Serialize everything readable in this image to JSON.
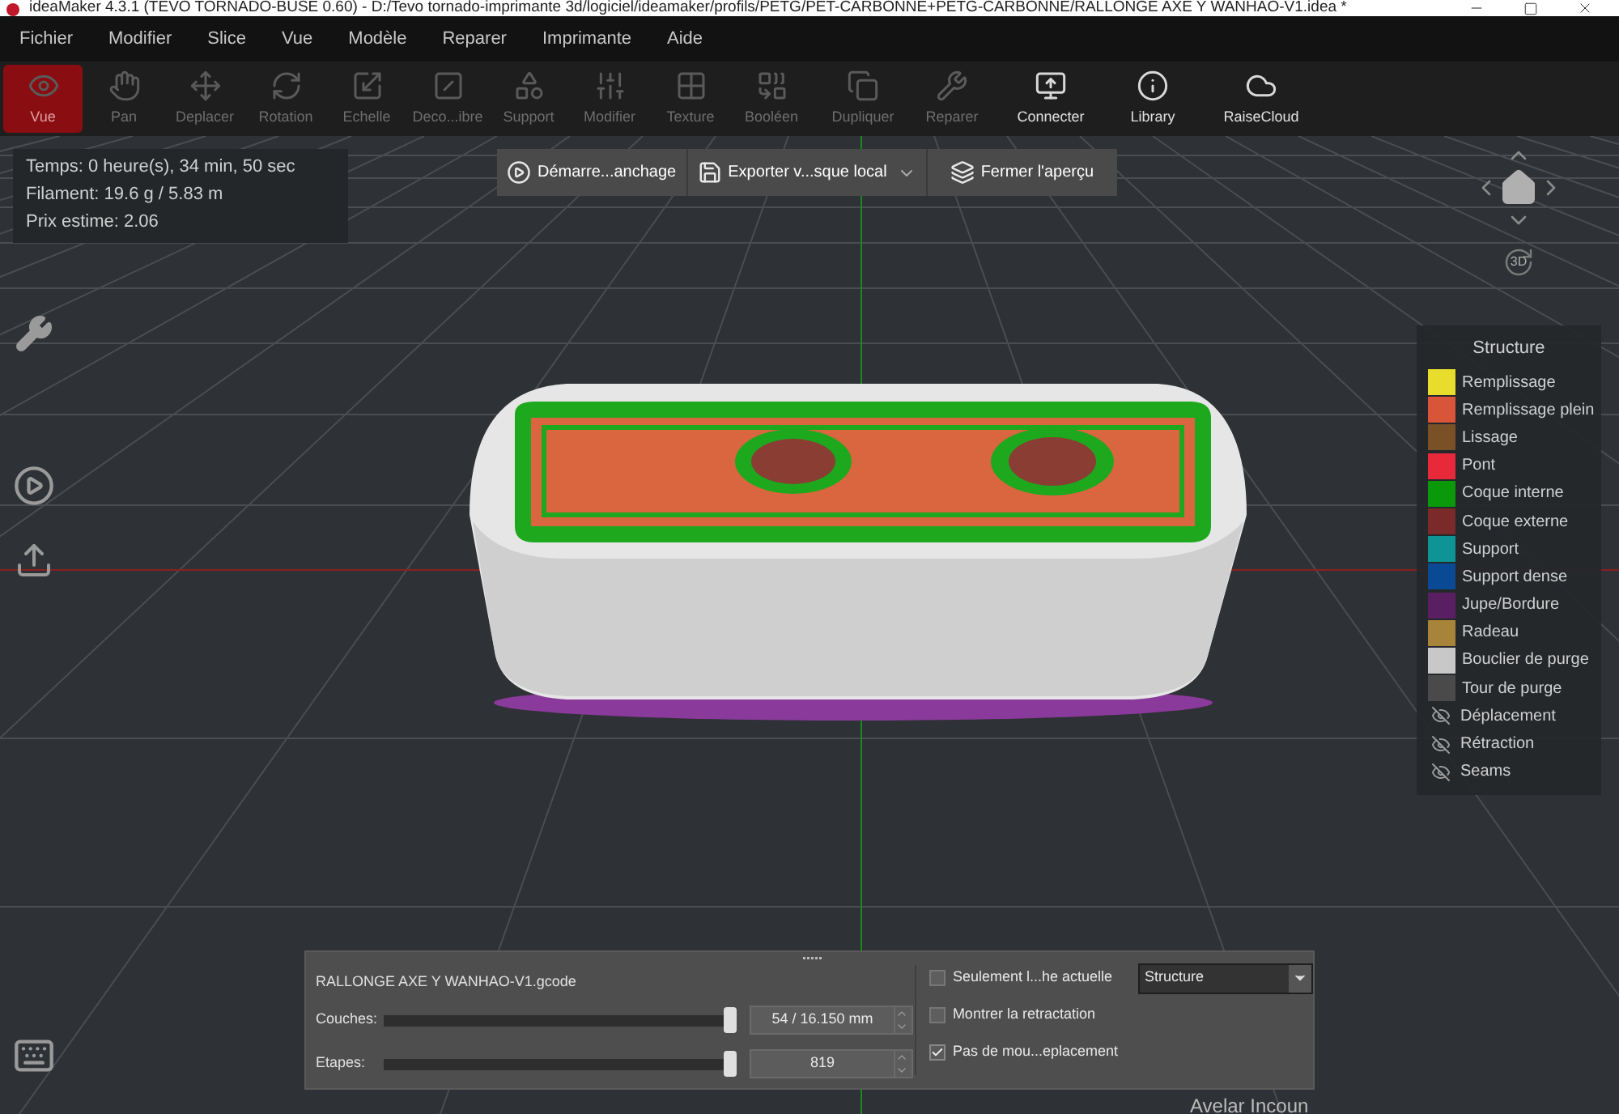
{
  "window": {
    "title": "ideaMaker 4.3.1 (TEVO TORNADO-BUSE 0.60) - D:/Tevo tornado-imprimante 3d/logiciel/ideamaker/profils/PETG/PET-CARBONNE+PETG-CARBONNE/RALLONGE AXE Y WANHAO-V1.idea *"
  },
  "menu": [
    "Fichier",
    "Modifier",
    "Slice",
    "Vue",
    "Modèle",
    "Reparer",
    "Imprimante",
    "Aide"
  ],
  "toolbar": [
    {
      "kind": "eye",
      "label": "Vue",
      "selected": true,
      "disabled": false
    },
    {
      "kind": "hand",
      "label": "Pan",
      "selected": false,
      "disabled": true
    },
    {
      "kind": "move",
      "label": "Deplacer",
      "selected": false,
      "disabled": true
    },
    {
      "kind": "rotate",
      "label": "Rotation",
      "selected": false,
      "disabled": true
    },
    {
      "kind": "scale",
      "label": "Echelle",
      "selected": false,
      "disabled": true
    },
    {
      "kind": "cut",
      "label": "Deco...ibre",
      "selected": false,
      "disabled": true
    },
    {
      "kind": "support",
      "label": "Support",
      "selected": false,
      "disabled": true
    },
    {
      "kind": "sliders",
      "label": "Modifier",
      "selected": false,
      "disabled": true
    },
    {
      "kind": "texture",
      "label": "Texture",
      "selected": false,
      "disabled": true
    },
    {
      "kind": "boolean",
      "label": "Booléen",
      "selected": false,
      "disabled": true
    },
    {
      "kind": "copy",
      "label": "Dupliquer",
      "selected": false,
      "disabled": true
    },
    {
      "kind": "repair",
      "label": "Reparer",
      "selected": false,
      "disabled": true
    },
    {
      "kind": "connect",
      "label": "Connecter",
      "selected": false,
      "disabled": false
    },
    {
      "kind": "info",
      "label": "Library",
      "selected": false,
      "disabled": false
    },
    {
      "kind": "cloud",
      "label": "RaiseCloud",
      "selected": false,
      "disabled": false
    }
  ],
  "stats": [
    "Temps: 0 heure(s), 34 min, 50 sec",
    "Filament: 19.6 g / 5.83 m",
    "Prix estime: 2.06"
  ],
  "preview_bar": [
    {
      "kind": "play",
      "label": "Démarre...anchage"
    },
    {
      "kind": "export",
      "label": "Exporter v...sque local"
    },
    {
      "kind": "close",
      "label": "Fermer l'aperçu"
    }
  ],
  "legend": {
    "title": "Structure",
    "items": [
      {
        "kind": "swatch",
        "label": "Remplissage",
        "color": "#e8dc2c"
      },
      {
        "kind": "swatch",
        "label": "Remplissage plein",
        "color": "#d9553a"
      },
      {
        "kind": "swatch",
        "label": "Lissage",
        "color": "#7a5126"
      },
      {
        "kind": "swatch",
        "label": "Pont",
        "color": "#e8293a"
      },
      {
        "kind": "swatch",
        "label": "Coque interne",
        "color": "#0a990a"
      },
      {
        "kind": "swatch",
        "label": "Coque externe",
        "color": "#7b2a2a"
      },
      {
        "kind": "swatch",
        "label": "Support",
        "color": "#0e9494"
      },
      {
        "kind": "swatch",
        "label": "Support dense",
        "color": "#0a4a94"
      },
      {
        "kind": "swatch",
        "label": "Jupe/Bordure",
        "color": "#5a1f63"
      },
      {
        "kind": "swatch",
        "label": "Radeau",
        "color": "#a8843a"
      },
      {
        "kind": "swatch",
        "label": "Bouclier de purge",
        "color": "#c8c8c8"
      },
      {
        "kind": "swatch",
        "label": "Tour de purge",
        "color": "#4a4a4a"
      },
      {
        "kind": "hidden",
        "label": "Déplacement"
      },
      {
        "kind": "hidden",
        "label": "Rétraction"
      },
      {
        "kind": "hidden",
        "label": "Seams"
      }
    ]
  },
  "nav_cube": {
    "label": "3D"
  },
  "layer_panel": {
    "file": "RALLONGE AXE Y WANHAO-V1.gcode",
    "sliders": [
      {
        "label": "Couches:",
        "level": 1,
        "value": "54 / 16.150 mm"
      },
      {
        "label": "Etapes:",
        "level": 1,
        "value": "819"
      }
    ],
    "options": [
      {
        "label": "Seulement l...he actuelle",
        "checked": false
      },
      {
        "label": "Montrer la retractation",
        "checked": false
      },
      {
        "label": "Pas de mou...eplacement",
        "checked": true
      }
    ],
    "view_select": "Structure"
  },
  "background_text": "Avelar Incoun"
}
